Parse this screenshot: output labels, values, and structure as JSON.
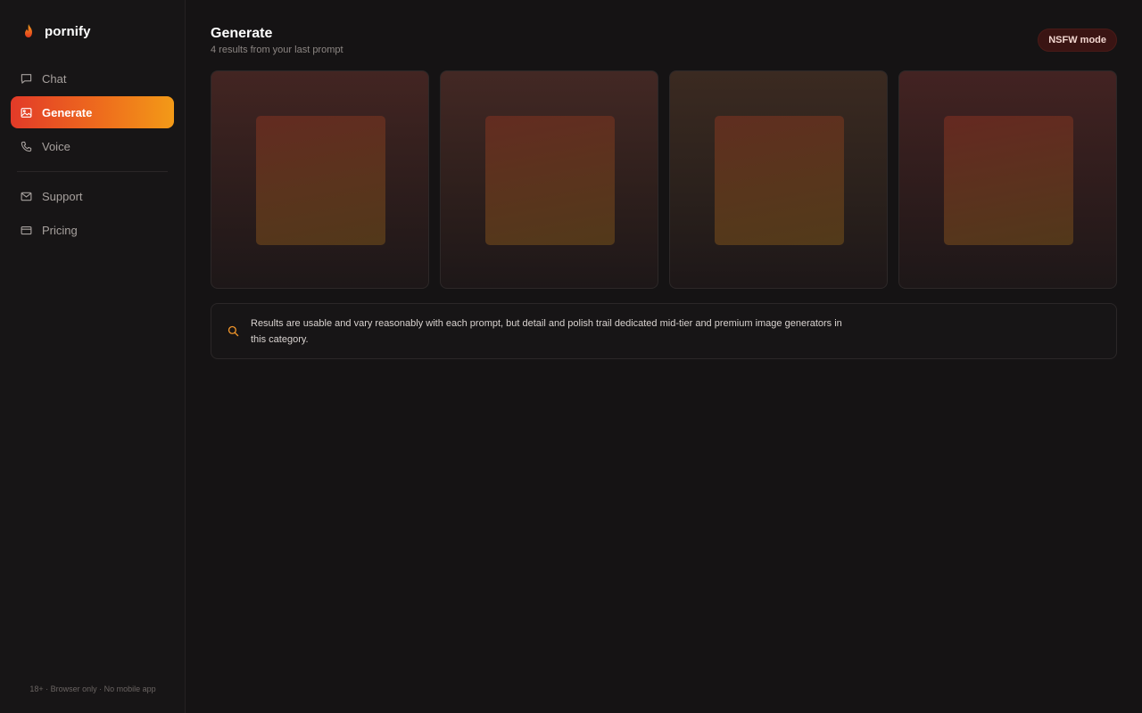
{
  "brand": {
    "name": "pornify",
    "icon": "flame-icon",
    "accent": "#ee5a22"
  },
  "sidebar": {
    "items": [
      {
        "label": "Chat",
        "icon": "chat-bubble-icon",
        "active": false
      },
      {
        "label": "Generate",
        "icon": "image-icon",
        "active": true
      },
      {
        "label": "Voice",
        "icon": "phone-icon",
        "active": false
      }
    ],
    "secondary_items": [
      {
        "label": "Support",
        "icon": "mail-icon"
      },
      {
        "label": "Pricing",
        "icon": "credit-card-icon"
      }
    ],
    "footer": "18+ · Browser only · No mobile app"
  },
  "main": {
    "title": "Generate",
    "subtitle": "4 results from your last prompt",
    "badge": "NSFW mode",
    "info": {
      "icon": "search-icon",
      "text": "Results are usable and vary reasonably with each prompt, but detail and polish trail dedicated mid-tier and premium image generators in this category."
    }
  },
  "colors": {
    "background": "#151314",
    "sidebar": "#171516",
    "active_gradient_start": "#e23a28",
    "active_gradient_end": "#f39a17",
    "badge_bg": "#3a1413"
  }
}
